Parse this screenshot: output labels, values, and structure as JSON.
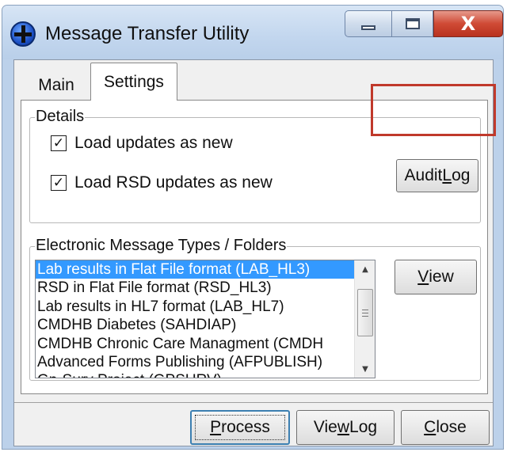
{
  "window": {
    "title": "Message Transfer Utility",
    "close_symbol": "X"
  },
  "tabs": [
    {
      "label": "Main",
      "active": false
    },
    {
      "label": "Settings",
      "active": true
    }
  ],
  "details": {
    "legend": "Details",
    "checkboxes": [
      {
        "label": "Load updates as new",
        "checked": true,
        "mark": "✓"
      },
      {
        "label": "Load RSD updates as new",
        "checked": true,
        "mark": "✓"
      }
    ],
    "audit_log_button": {
      "pre": "Audit ",
      "accel": "L",
      "post": "og"
    }
  },
  "folders": {
    "legend": "Electronic Message Types / Folders",
    "items": [
      {
        "label": "Lab results in Flat File format (LAB_HL3)",
        "selected": true
      },
      {
        "label": "RSD in Flat File format (RSD_HL3)",
        "selected": false
      },
      {
        "label": "Lab results in HL7 format (LAB_HL7)",
        "selected": false
      },
      {
        "label": "CMDHB Diabetes (SAHDIAP)",
        "selected": false
      },
      {
        "label": "CMDHB Chronic Care Managment (CMDH",
        "selected": false
      },
      {
        "label": "Advanced Forms Publishing (AFPUBLISH)",
        "selected": false
      },
      {
        "label": "Gp-Surv Project (GPSURV)",
        "selected": false
      }
    ],
    "view_button": {
      "pre": "",
      "accel": "V",
      "post": "iew"
    }
  },
  "footer": {
    "process_button": {
      "pre": "",
      "accel": "P",
      "post": "rocess"
    },
    "view_log_button": {
      "pre": "Vie",
      "accel": "w",
      "post": " Log"
    },
    "close_button": {
      "pre": "",
      "accel": "C",
      "post": "lose"
    }
  },
  "colors": {
    "selection": "#3399ff",
    "highlight_box": "#c0392b",
    "titlebar": "#c2d6ee",
    "close_button": "#cf4a35"
  },
  "icons": {
    "app": "blue-cross-globe-icon",
    "minimize": "minimize-icon",
    "maximize": "maximize-icon",
    "close": "close-icon"
  }
}
